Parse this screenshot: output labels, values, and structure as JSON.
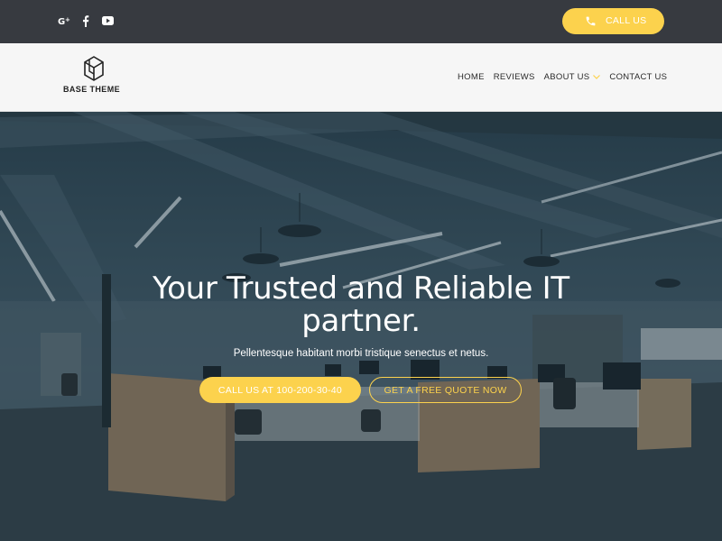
{
  "topbar": {
    "social_icons": [
      "google-plus-icon",
      "facebook-icon",
      "youtube-icon"
    ],
    "call_label": "CALL US",
    "call_icon": "phone-icon"
  },
  "header": {
    "logo_text": "BASE THEME",
    "nav": [
      {
        "label": "HOME"
      },
      {
        "label": "REVIEWS"
      },
      {
        "label": "ABOUT US",
        "has_dropdown": true
      },
      {
        "label": "CONTACT US"
      }
    ]
  },
  "hero": {
    "title": "Your Trusted and Reliable IT partner.",
    "subtitle": "Pellentesque habitant morbi tristique senectus et netus.",
    "primary_button": "CALL US AT 100-200-30-40",
    "secondary_button": "GET A FREE QUOTE NOW"
  },
  "colors": {
    "accent": "#fcd24d",
    "topbar_bg": "#373a40",
    "header_bg": "#f6f6f6"
  }
}
